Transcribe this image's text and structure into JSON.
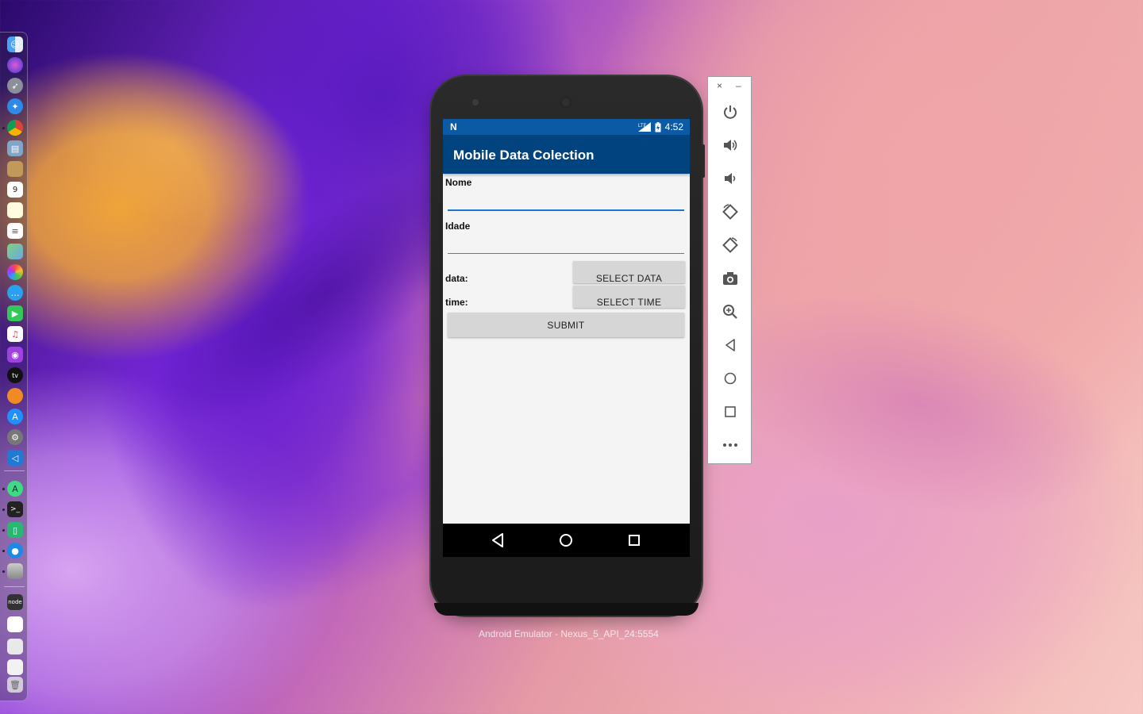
{
  "colors": {
    "status_bar": "#0a5aa6",
    "app_bar": "#01437f",
    "input_active_line": "#1976d2",
    "screen_bg": "#f4f4f4",
    "button_bg": "#d6d6d6"
  },
  "dock": {
    "icons": [
      "finder-icon",
      "siri-icon",
      "launchpad-icon",
      "safari-icon",
      "chrome-icon",
      "preview-icon",
      "contacts-icon",
      "calendar-icon",
      "notes-icon",
      "reminders-icon",
      "maps-icon",
      "photos-icon",
      "messages-icon",
      "facetime-icon",
      "music-icon",
      "podcasts-icon",
      "apple-tv-icon",
      "books-icon",
      "app-store-icon",
      "system-preferences-icon",
      "vscode-icon",
      "android-studio-icon",
      "terminal-icon",
      "android-emulator-icon",
      "location-icon",
      "database-icon",
      "node-icon",
      "document-icon",
      "downloads-icon",
      "window-icon",
      "trash-icon"
    ]
  },
  "phone": {
    "status_bar": {
      "time": "4:52",
      "network": "LTE"
    },
    "app_title": "Mobile Data Colection",
    "form": {
      "nome_label": "Nome",
      "nome_value": "",
      "idade_label": "Idade",
      "idade_value": "",
      "data_label": "data:",
      "time_label": "time:",
      "select_data_button": "SELECT DATA",
      "select_time_button": "SELECT TIME",
      "submit_button": "SUBMIT"
    }
  },
  "emulator_label": "Android Emulator - Nexus_5_API_24:5554",
  "toolbar": {
    "close_label": "×",
    "minimize_label": "–",
    "icons": [
      "power-icon",
      "volume-up-icon",
      "volume-down-icon",
      "rotate-left-icon",
      "rotate-right-icon",
      "camera-icon",
      "zoom-icon",
      "back-icon",
      "home-icon",
      "overview-icon",
      "more-icon"
    ]
  }
}
